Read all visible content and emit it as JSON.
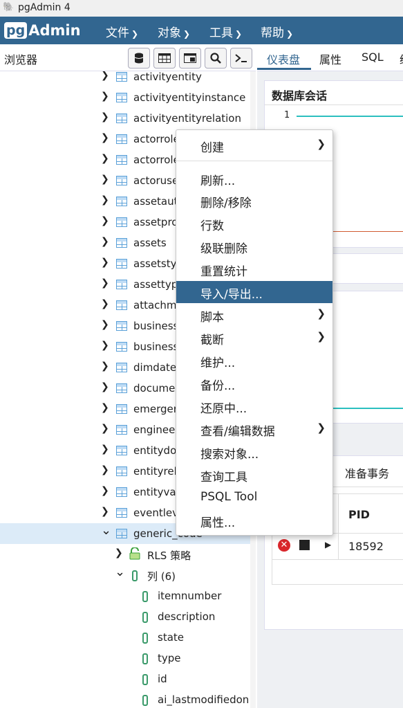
{
  "window": {
    "title": "pgAdmin 4"
  },
  "app": {
    "logo_pg": "pg",
    "logo_admin": "Admin"
  },
  "menubar": {
    "items": [
      "文件",
      "对象",
      "工具",
      "帮助"
    ]
  },
  "browser": {
    "title": "浏览器",
    "toolbar_icons": [
      "database-icon",
      "table-grid-icon",
      "filtered-rows-icon",
      "search-icon",
      "terminal-icon"
    ],
    "tables": [
      "activityentity",
      "activityentityinstance",
      "activityentityrelation",
      "actorrole",
      "actorrole",
      "actoruse",
      "assetaut",
      "assetpro",
      "assets",
      "assetsty",
      "assettyp",
      "attachm",
      "business",
      "business",
      "dimdate",
      "docume",
      "emerger",
      "engineer",
      "entitydo",
      "entityrel",
      "entityval",
      "eventlev"
    ],
    "expanded_table": "generic_code",
    "rls": "RLS 策略",
    "columns_node": "列 (6)",
    "columns": [
      "itemnumber",
      "description",
      "state",
      "type",
      "id",
      "ai_lastmodifiedon"
    ]
  },
  "right": {
    "tabs": [
      "仪表盘",
      "属性",
      "SQL",
      "统"
    ],
    "card_title": "数据库会话",
    "chart_tick": "1",
    "prepared_tab": "准备事务",
    "grid_header_pid": "PID",
    "grid_row_pid": "18592"
  },
  "context_menu": {
    "items": [
      {
        "label": "创建",
        "sub": true
      },
      {
        "label": "刷新...",
        "sub": false
      },
      {
        "label": "删除/移除",
        "sub": false
      },
      {
        "label": "行数",
        "sub": false
      },
      {
        "label": "级联删除",
        "sub": false
      },
      {
        "label": "重置统计",
        "sub": false
      },
      {
        "label": "导入/导出...",
        "sub": false,
        "highlighted": true
      },
      {
        "label": "脚本",
        "sub": true
      },
      {
        "label": "截断",
        "sub": true
      },
      {
        "label": "维护...",
        "sub": false
      },
      {
        "label": "备份...",
        "sub": false
      },
      {
        "label": "还原中...",
        "sub": false
      },
      {
        "label": "查看/编辑数据",
        "sub": true
      },
      {
        "label": "搜索对象...",
        "sub": false
      },
      {
        "label": "查询工具",
        "sub": false
      },
      {
        "label": "PSQL Tool",
        "sub": false
      },
      {
        "label": "属性...",
        "sub": false
      }
    ]
  },
  "colors": {
    "brand": "#326690",
    "highlight": "#326690",
    "selected_row": "#dcebf8"
  }
}
